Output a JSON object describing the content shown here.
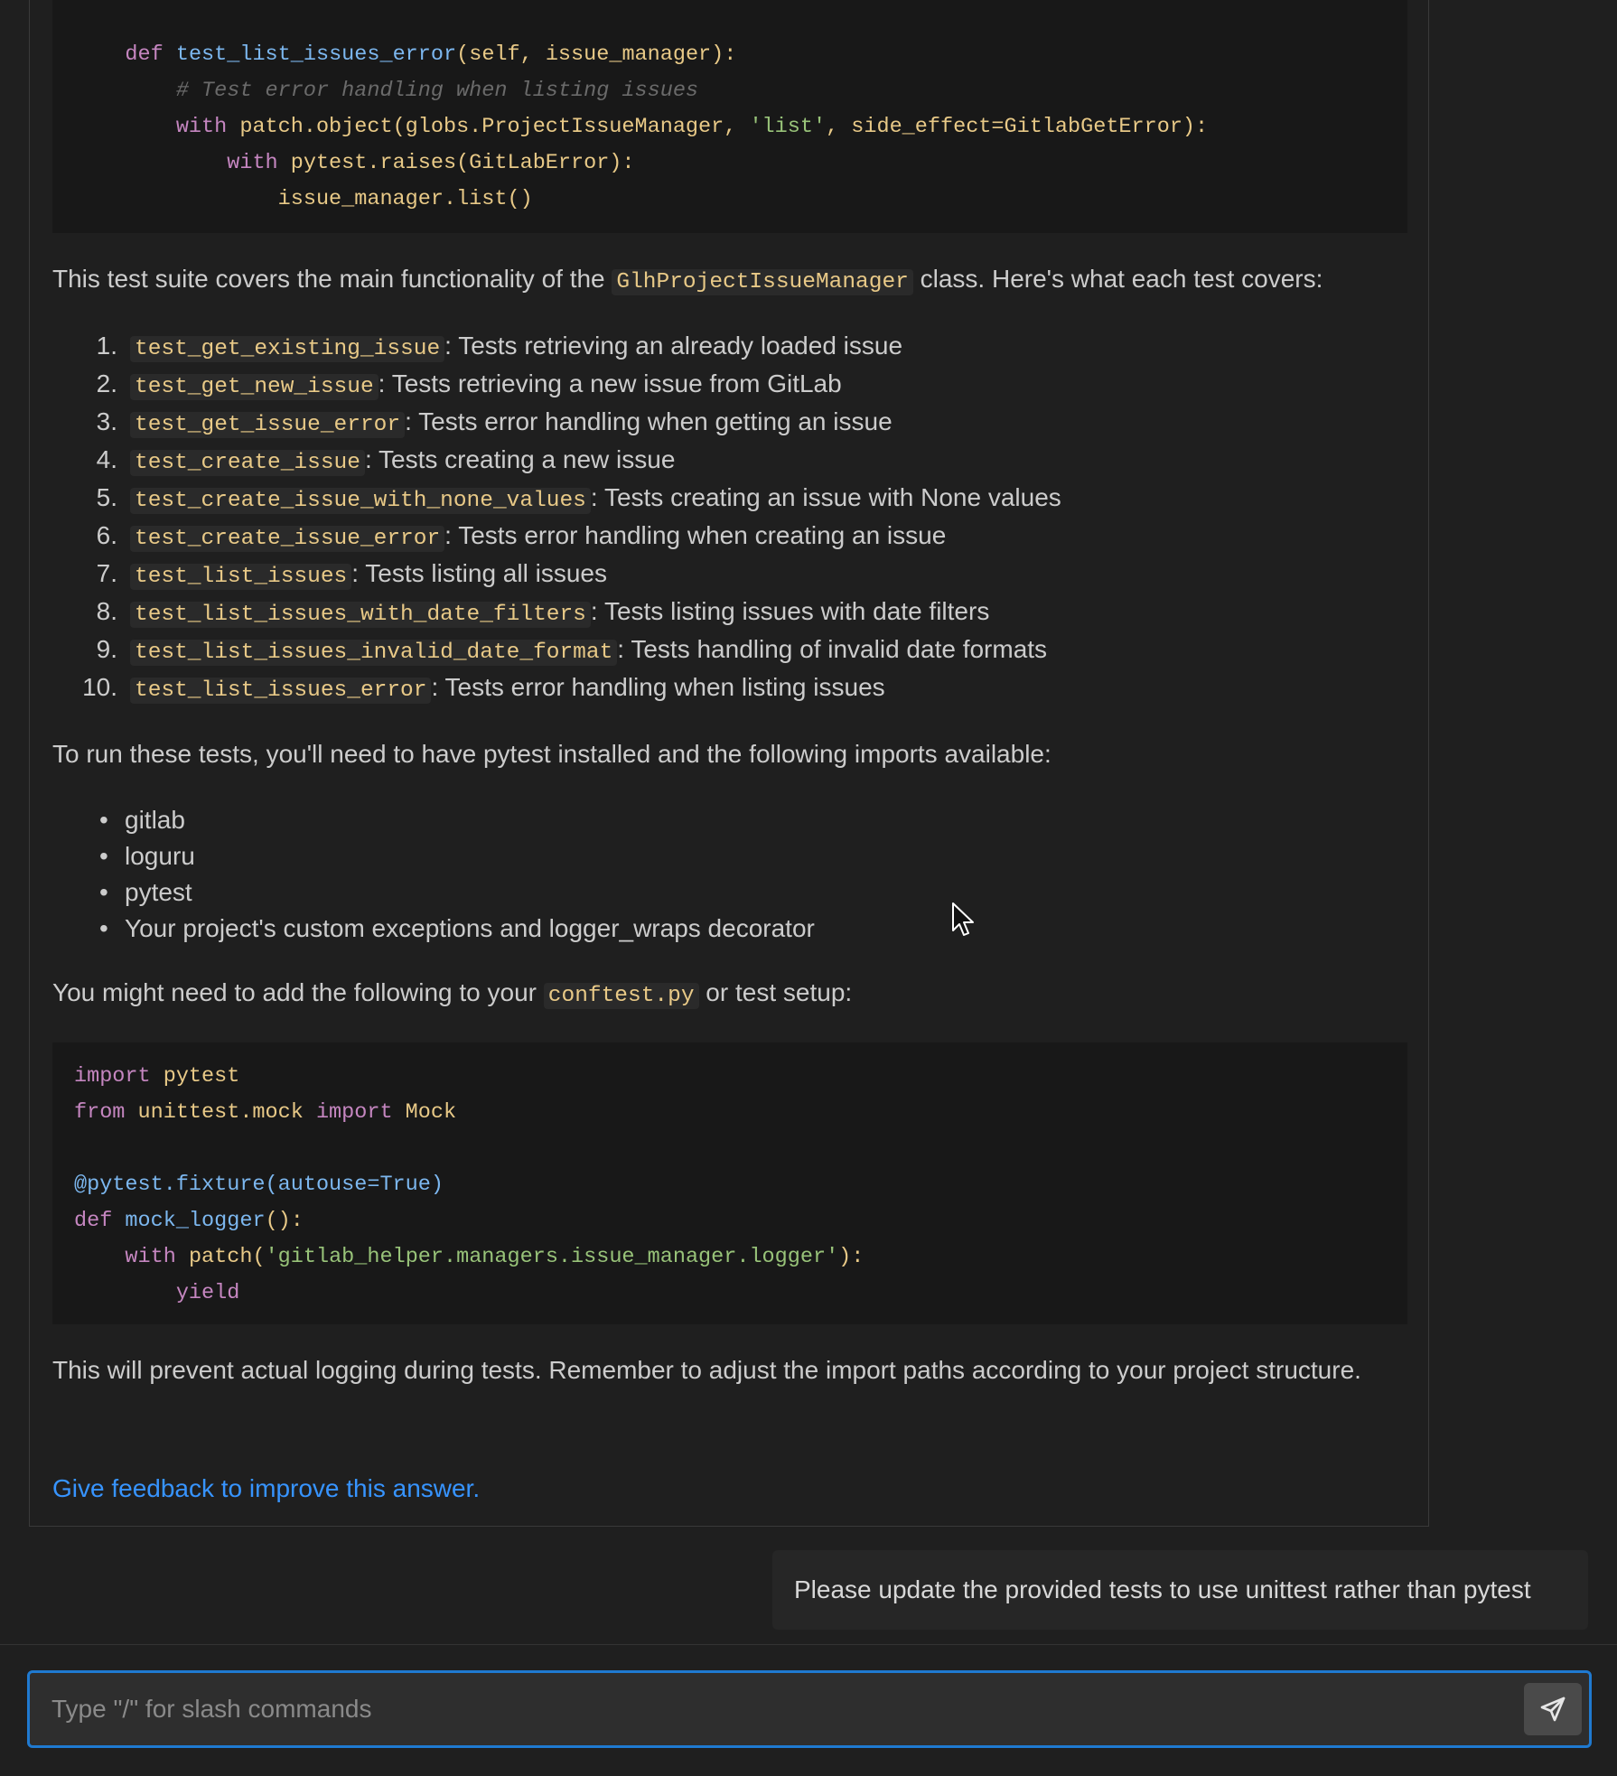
{
  "code_top": {
    "lines": [
      [
        {
          "c": "ind",
          "t": "    "
        },
        {
          "c": "kw",
          "t": "def "
        },
        {
          "c": "fn",
          "t": "test_list_issues_error"
        },
        {
          "c": "tx",
          "t": "(self, issue_manager):"
        }
      ],
      [
        {
          "c": "ind",
          "t": "        "
        },
        {
          "c": "cm",
          "t": "# Test error handling when listing issues"
        }
      ],
      [
        {
          "c": "ind",
          "t": "        "
        },
        {
          "c": "kw",
          "t": "with "
        },
        {
          "c": "tx",
          "t": "patch.object(globs.ProjectIssueManager, "
        },
        {
          "c": "st",
          "t": "'list'"
        },
        {
          "c": "tx",
          "t": ", side_effect=GitlabGetError):"
        }
      ],
      [
        {
          "c": "ind",
          "t": "            "
        },
        {
          "c": "kw",
          "t": "with "
        },
        {
          "c": "tx",
          "t": "pytest.raises(GitLabError):"
        }
      ],
      [
        {
          "c": "ind",
          "t": "                "
        },
        {
          "c": "tx",
          "t": "issue_manager.list()"
        }
      ]
    ]
  },
  "intro": {
    "before": "This test suite covers the main functionality of the ",
    "code": "GlhProjectIssueManager",
    "after": " class. Here's what each test covers:"
  },
  "tests": [
    {
      "num": "1.",
      "name": "test_get_existing_issue",
      "desc": ": Tests retrieving an already loaded issue"
    },
    {
      "num": "2.",
      "name": "test_get_new_issue",
      "desc": ": Tests retrieving a new issue from GitLab"
    },
    {
      "num": "3.",
      "name": "test_get_issue_error",
      "desc": ": Tests error handling when getting an issue"
    },
    {
      "num": "4.",
      "name": "test_create_issue",
      "desc": ": Tests creating a new issue"
    },
    {
      "num": "5.",
      "name": "test_create_issue_with_none_values",
      "desc": ": Tests creating an issue with None values"
    },
    {
      "num": "6.",
      "name": "test_create_issue_error",
      "desc": ": Tests error handling when creating an issue"
    },
    {
      "num": "7.",
      "name": "test_list_issues",
      "desc": ": Tests listing all issues"
    },
    {
      "num": "8.",
      "name": "test_list_issues_with_date_filters",
      "desc": ": Tests listing issues with date filters"
    },
    {
      "num": "9.",
      "name": "test_list_issues_invalid_date_format",
      "desc": ": Tests handling of invalid date formats"
    },
    {
      "num": "10.",
      "name": "test_list_issues_error",
      "desc": ": Tests error handling when listing issues"
    }
  ],
  "run_text": "To run these tests, you'll need to have pytest installed and the following imports available:",
  "imports": [
    "gitlab",
    "loguru",
    "pytest",
    "Your project's custom exceptions and logger_wraps decorator"
  ],
  "conftest": {
    "before": "You might need to add the following to your ",
    "code": "conftest.py",
    "after": " or test setup:"
  },
  "code_bottom": {
    "lines": [
      [
        {
          "c": "kw",
          "t": "import "
        },
        {
          "c": "tx",
          "t": "pytest"
        }
      ],
      [
        {
          "c": "kw",
          "t": "from "
        },
        {
          "c": "tx",
          "t": "unittest.mock "
        },
        {
          "c": "kw",
          "t": "import "
        },
        {
          "c": "tx",
          "t": "Mock"
        }
      ],
      [],
      [
        {
          "c": "dc",
          "t": "@pytest.fixture(autouse=True)"
        }
      ],
      [
        {
          "c": "kw",
          "t": "def "
        },
        {
          "c": "fn",
          "t": "mock_logger"
        },
        {
          "c": "tx",
          "t": "():"
        }
      ],
      [
        {
          "c": "ind",
          "t": "    "
        },
        {
          "c": "kw",
          "t": "with "
        },
        {
          "c": "tx",
          "t": "patch("
        },
        {
          "c": "st",
          "t": "'gitlab_helper.managers.issue_manager.logger'"
        },
        {
          "c": "tx",
          "t": "):"
        }
      ],
      [
        {
          "c": "ind",
          "t": "        "
        },
        {
          "c": "kw",
          "t": "yield"
        }
      ]
    ]
  },
  "closing_text": "This will prevent actual logging during tests. Remember to adjust the import paths according to your project structure.",
  "feedback_link": "Give feedback to improve this answer.",
  "user_message": "Please update the provided tests to use unittest rather than pytest",
  "chat_input": {
    "placeholder": "Type \"/\" for slash commands",
    "value": ""
  },
  "icons": {
    "send": "send-icon",
    "cursor": "mouse-pointer-icon"
  },
  "colors": {
    "link": "#3794ff",
    "input_border": "#1f7ad1",
    "keyword": "#c586c0",
    "function": "#7cb7ef",
    "string": "#98c379",
    "code_text": "#e8c987"
  }
}
